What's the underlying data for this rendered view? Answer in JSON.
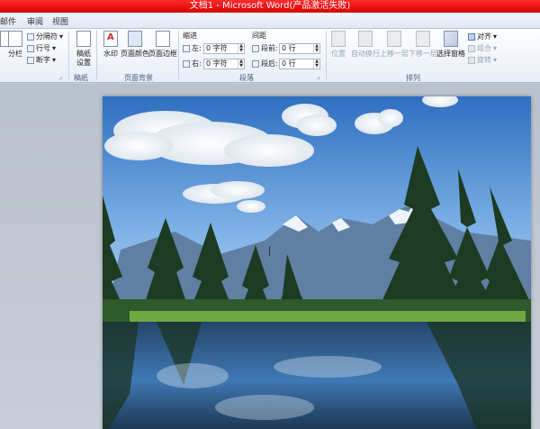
{
  "window": {
    "title": "文档1 - Microsoft Word(产品激活失败)"
  },
  "tabs": [
    "邮件",
    "审阅",
    "视图"
  ],
  "ribbon": {
    "page_setup": {
      "columns": "分栏",
      "breaks": "分隔符",
      "line_numbers": "行号",
      "hyphenation": "断字"
    },
    "manuscript": {
      "button": "稿纸\n设置",
      "group_label": "稿纸"
    },
    "page_background": {
      "watermark": "水印",
      "page_color": "页面颜色",
      "page_borders": "页面边框",
      "group_label": "页面背景"
    },
    "paragraph": {
      "indent_header": "缩进",
      "left_label": "左:",
      "left_value": "0 字符",
      "right_label": "右:",
      "right_value": "0 字符",
      "spacing_header": "间距",
      "before_label": "段前:",
      "before_value": "0 行",
      "after_label": "段后:",
      "after_value": "0 行",
      "group_label": "段落"
    },
    "arrange": {
      "position": "位置",
      "wrap_text": "自动换行",
      "bring_forward": "上移一层",
      "send_backward": "下移一层",
      "selection_pane": "选择窗格",
      "align": "对齐",
      "group": "组合",
      "rotate": "旋转",
      "group_label": "排列"
    }
  }
}
